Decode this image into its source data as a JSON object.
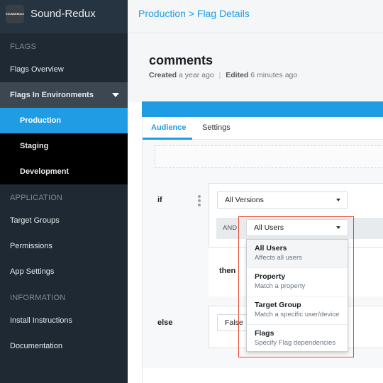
{
  "app": {
    "name": "Sound-Redux",
    "logo_text": "SOUNDREDUX"
  },
  "sidebar": {
    "sections": {
      "flags": "FLAGS",
      "application": "APPLICATION",
      "information": "INFORMATION"
    },
    "items": {
      "flags_overview": "Flags Overview",
      "flags_in_environments": "Flags In Environments",
      "production": "Production",
      "staging": "Staging",
      "development": "Development",
      "target_groups": "Target Groups",
      "permissions": "Permissions",
      "app_settings": "App Settings",
      "install_instructions": "Install Instructions",
      "documentation": "Documentation"
    }
  },
  "header": {
    "breadcrumb": "Production > Flag Details"
  },
  "flag": {
    "name": "comments",
    "created_label": "Created",
    "created_value": "a year ago",
    "separator": "|",
    "edited_label": "Edited",
    "edited_value": "6 minutes ago"
  },
  "tabs": {
    "audience": "Audience",
    "settings": "Settings"
  },
  "rules": {
    "if_label": "if",
    "then_label": "then",
    "else_label": "else",
    "and_label": "AND",
    "versions_select": "All Versions",
    "users_select": "All Users",
    "else_select": "False"
  },
  "menu": {
    "items": [
      {
        "title": "All Users",
        "desc": "Affects all users"
      },
      {
        "title": "Property",
        "desc": "Match a property"
      },
      {
        "title": "Target Group",
        "desc": "Match a specific user/device"
      },
      {
        "title": "Flags",
        "desc": "Specify Flag dependencies"
      }
    ]
  },
  "colors": {
    "accent": "#1f9ce4",
    "sidebar": "#1f2933",
    "highlight": "#e8472e"
  }
}
